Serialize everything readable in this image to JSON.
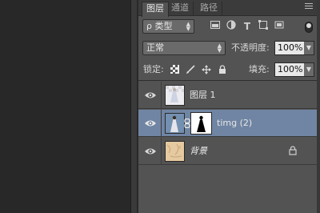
{
  "tabs": [
    {
      "label": "图层",
      "active": true
    },
    {
      "label": "通道",
      "active": false
    },
    {
      "label": "路径",
      "active": false
    }
  ],
  "filter": {
    "kind_label": "ρ 类型",
    "icons": [
      "image-filter-icon",
      "adjustment-filter-icon",
      "type-filter-icon",
      "shape-filter-icon",
      "smart-object-filter-icon"
    ],
    "type_glyph": "T"
  },
  "blend": {
    "mode": "正常",
    "opacity_label": "不透明度:",
    "opacity_value": "100%"
  },
  "lock": {
    "label": "锁定:",
    "fill_label": "填充:",
    "fill_value": "100%"
  },
  "layers": [
    {
      "name": "图层 1",
      "visible": true,
      "selected": false
    },
    {
      "name": "timg (2)",
      "visible": true,
      "selected": true,
      "has_mask": true
    },
    {
      "name": "背景",
      "visible": true,
      "selected": false,
      "locked": true
    }
  ],
  "colors": {
    "panel_bg": "#535353",
    "selected_layer": "#7085a3"
  }
}
